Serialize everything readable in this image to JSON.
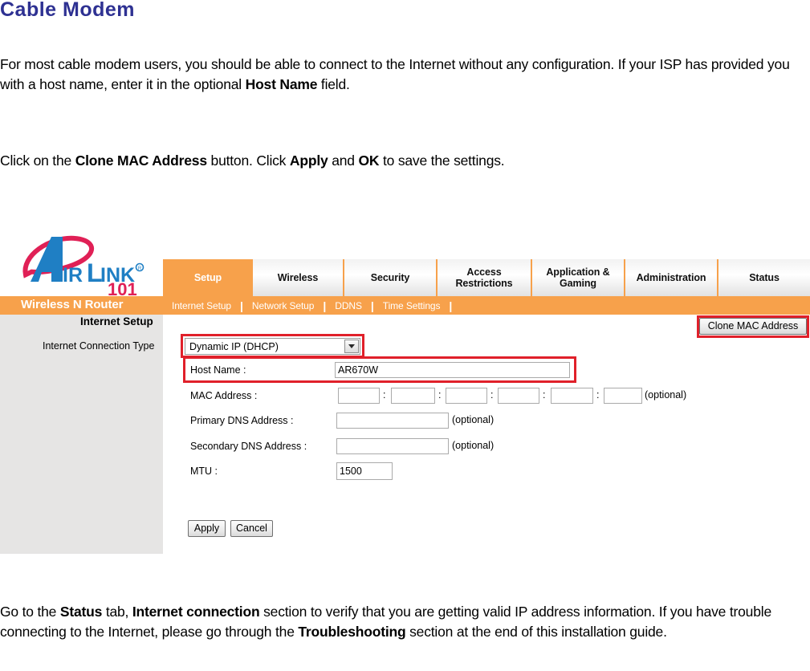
{
  "document": {
    "title": "Cable Modem",
    "intro_paragraph": {
      "part1": "For most cable modem users, you should be able to connect to the Internet without any configuration. If your ISP has provided you with a host name, enter it in the optional ",
      "bold1": "Host Name",
      "part2": " field."
    },
    "click_paragraph": {
      "part1": "Click on the ",
      "bold1": "Clone MAC Address",
      "part2": " button. Click ",
      "bold2": "Apply",
      "part3": " and ",
      "bold3": "OK",
      "part4": " to save the settings."
    },
    "closing_paragraph": {
      "part1": "Go to the ",
      "bold1": "Status",
      "part2": " tab, ",
      "bold2": "Internet connection",
      "part3": " section to verify that you are getting valid IP address information.  If you have trouble connecting to the Internet, please go through the ",
      "bold3": "Troubleshooting",
      "part4": " section at the end of this installation guide."
    }
  },
  "router_ui": {
    "brand": {
      "name": "AIRLINK",
      "name_a": "A",
      "name_rest": "IR",
      "name_l": "L",
      "name_ink": "INK",
      "model": "101",
      "registered": "®",
      "product_name": "Wireless N Router"
    },
    "tabs": [
      {
        "label": "Setup",
        "active": true
      },
      {
        "label": "Wireless",
        "active": false
      },
      {
        "label": "Security",
        "active": false
      },
      {
        "label": "Access Restrictions",
        "active": false
      },
      {
        "label": "Application & Gaming",
        "active": false
      },
      {
        "label": "Administration",
        "active": false
      },
      {
        "label": "Status",
        "active": false
      }
    ],
    "subnav": [
      {
        "label": "Internet Setup"
      },
      {
        "label": "Network Setup"
      },
      {
        "label": "DDNS"
      },
      {
        "label": "Time Settings"
      }
    ],
    "subnav_separator": "|",
    "form": {
      "section_heading": "Internet Setup",
      "connection_type_label": "Internet Connection Type",
      "connection_type_value": "Dynamic IP (DHCP)",
      "host_name_label": "Host Name :",
      "host_name_value": "AR670W",
      "mac_address_label": "MAC Address :",
      "mac_octets": [
        "",
        "",
        "",
        "",
        "",
        ""
      ],
      "mac_separator": ":",
      "mac_optional_note": "(optional)",
      "clone_button_label": "Clone MAC Address",
      "primary_dns_label": "Primary DNS Address :",
      "primary_dns_value": "",
      "primary_dns_optional": "(optional)",
      "secondary_dns_label": "Secondary DNS Address :",
      "secondary_dns_value": "",
      "secondary_dns_optional": "(optional)",
      "mtu_label": "MTU :",
      "mtu_value": "1500",
      "apply_button_label": "Apply",
      "cancel_button_label": "Cancel"
    },
    "colors": {
      "accent_orange": "#f7a14b",
      "highlight_red": "#e0202a",
      "title_blue": "#2e3192",
      "logo_blue": "#1f7fc4",
      "logo_red": "#e02056",
      "panel_gray": "#e6e5e4"
    }
  }
}
